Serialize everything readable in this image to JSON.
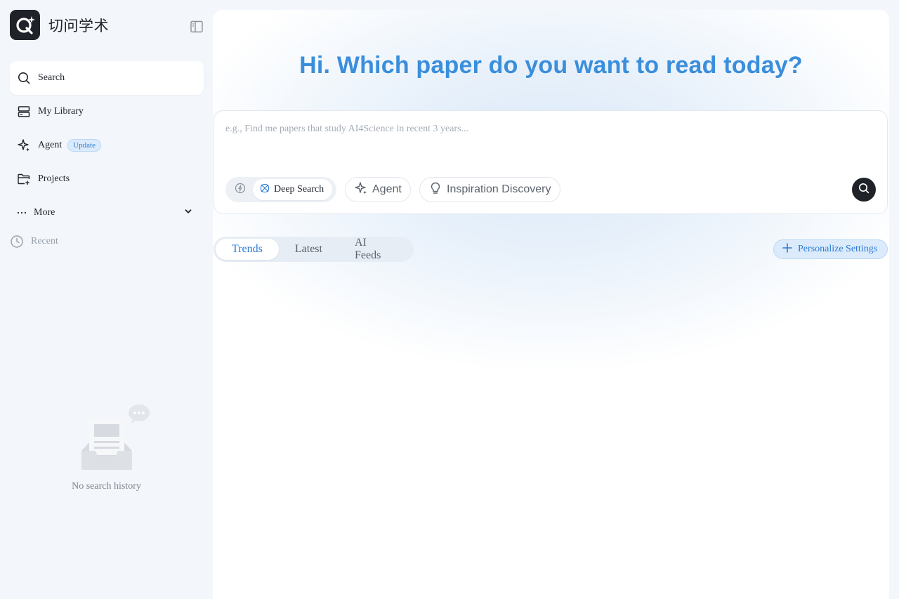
{
  "brand": {
    "name": "切问学术",
    "logo_icon": "q-logo-icon"
  },
  "sidebar": {
    "collapse_icon": "sidebar-toggle-icon",
    "items": [
      {
        "label": "Search",
        "icon": "search-icon",
        "active": true
      },
      {
        "label": "My Library",
        "icon": "library-icon"
      },
      {
        "label": "Agent",
        "icon": "sparkle-icon",
        "badge": "Update"
      },
      {
        "label": "Projects",
        "icon": "folder-add-icon"
      },
      {
        "label": "More",
        "icon": "ellipsis-icon"
      }
    ],
    "recent_label": "Recent",
    "empty_text": "No search history"
  },
  "main": {
    "headline": "Hi. Which paper do you want to read today?",
    "search": {
      "placeholder": "e.g., Find me papers that study AI4Science in recent 3 years...",
      "value": ""
    },
    "modes": {
      "deep_label": "Deep Search"
    },
    "pills": {
      "agent": "Agent",
      "inspiration": "Inspiration Discovery"
    },
    "tabs": [
      {
        "label": "Trends",
        "active": true
      },
      {
        "label": "Latest"
      },
      {
        "label": "AI Feeds"
      }
    ],
    "personalize_label": "Personalize Settings"
  },
  "colors": {
    "accent": "#3a8edb",
    "link": "#2b7bd6",
    "dark": "#1f2329",
    "badge_bg": "#dcebfb"
  }
}
